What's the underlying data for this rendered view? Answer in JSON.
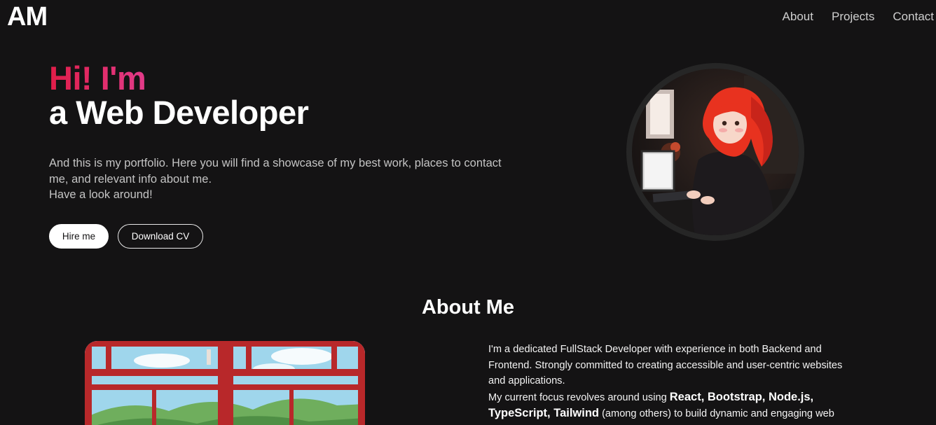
{
  "header": {
    "logo": "AM",
    "nav": [
      "About",
      "Projects",
      "Contact"
    ]
  },
  "hero": {
    "greeting": "Hi! I'm",
    "title": "a Web Developer",
    "description_lines": [
      "And this is my portfolio. Here you will find a showcase of my best work, places to contact",
      "me, and relevant info about me.",
      "Have a look around!"
    ],
    "buttons": {
      "hire": "Hire me",
      "cv": "Download CV"
    }
  },
  "about": {
    "title": "About Me",
    "paragraph1": "I'm a dedicated FullStack Developer with experience in both Backend and Frontend. Strongly committed to creating accessible and user-centric websites and applications.",
    "focus_prefix": "My current focus revolves around using",
    "focus_tech": "React, Bootstrap, Node.js, TypeScript, Tailwind",
    "focus_suffix": "(among others) to build dynamic and engaging web"
  },
  "colors": {
    "background": "#141314",
    "accent_start": "#e11d48",
    "accent_end": "#e23b8a"
  },
  "icons": {
    "avatar": "illustrated-red-haired-developer",
    "about_image": "window-landscape-illustration"
  }
}
